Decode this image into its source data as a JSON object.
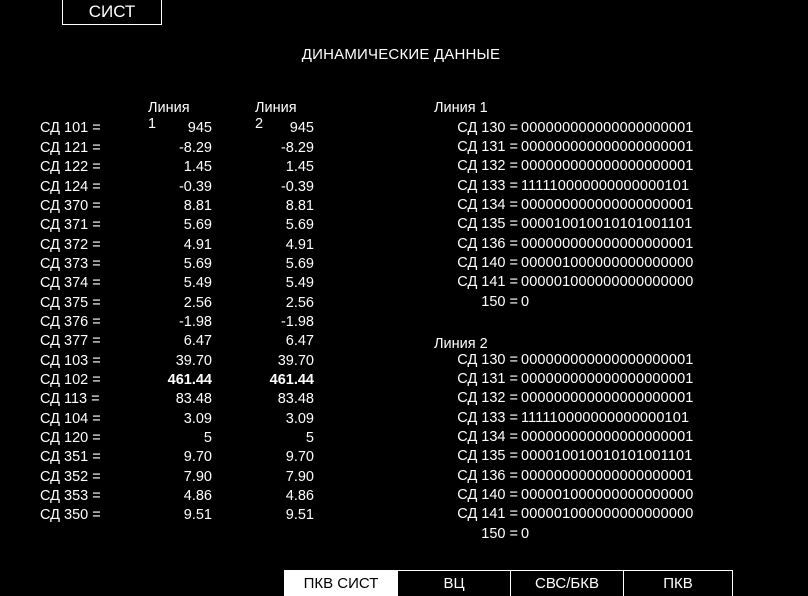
{
  "header": {
    "sist_button": "СИСТ",
    "title": "ДИНАМИЧЕСКИЕ ДАННЫЕ"
  },
  "left": {
    "col1": "Линия 1",
    "col2": "Линия 2",
    "rows": [
      {
        "label": "СД 101 =",
        "v1": "945",
        "v2": "945"
      },
      {
        "label": "СД 121 =",
        "v1": "-8.29",
        "v2": "-8.29"
      },
      {
        "label": "СД 122 =",
        "v1": "1.45",
        "v2": "1.45"
      },
      {
        "label": "СД 124 =",
        "v1": "-0.39",
        "v2": "-0.39"
      },
      {
        "label": "СД 370 =",
        "v1": "8.81",
        "v2": "8.81"
      },
      {
        "label": "СД 371 =",
        "v1": "5.69",
        "v2": "5.69"
      },
      {
        "label": "СД 372 =",
        "v1": "4.91",
        "v2": "4.91"
      },
      {
        "label": "СД 373 =",
        "v1": "5.69",
        "v2": "5.69"
      },
      {
        "label": "СД 374 =",
        "v1": "5.49",
        "v2": "5.49"
      },
      {
        "label": "СД 375 =",
        "v1": "2.56",
        "v2": "2.56"
      },
      {
        "label": "СД 376 =",
        "v1": "-1.98",
        "v2": "-1.98"
      },
      {
        "label": "СД 377 =",
        "v1": "6.47",
        "v2": "6.47"
      },
      {
        "label": "СД 103 =",
        "v1": "39.70",
        "v2": "39.70"
      },
      {
        "label": "СД 102 =",
        "v1": "461.44",
        "v2": "461.44"
      },
      {
        "label": "СД 113 =",
        "v1": "83.48",
        "v2": "83.48"
      },
      {
        "label": "СД 104 =",
        "v1": "3.09",
        "v2": "3.09"
      },
      {
        "label": "СД 120 =",
        "v1": "5",
        "v2": "5"
      },
      {
        "label": "СД 351 =",
        "v1": "9.70",
        "v2": "9.70"
      },
      {
        "label": "СД 352 =",
        "v1": "7.90",
        "v2": "7.90"
      },
      {
        "label": "СД 353 =",
        "v1": "4.86",
        "v2": "4.86"
      },
      {
        "label": "СД 350 =",
        "v1": "9.51",
        "v2": "9.51"
      }
    ]
  },
  "right": {
    "line1": {
      "header": "Линия 1",
      "rows": [
        {
          "label": "СД 130 =",
          "value": "000000000000000000001"
        },
        {
          "label": "СД 131 =",
          "value": "000000000000000000001"
        },
        {
          "label": "СД 132 =",
          "value": "000000000000000000001"
        },
        {
          "label": "СД 133 =",
          "value": "111110000000000000101"
        },
        {
          "label": "СД 134 =",
          "value": "000000000000000000001"
        },
        {
          "label": "СД 135 =",
          "value": "000010010010101001101"
        },
        {
          "label": "СД 136 =",
          "value": "000000000000000000001"
        },
        {
          "label": "СД 140 =",
          "value": "000001000000000000000"
        },
        {
          "label": "СД 141 =",
          "value": "000001000000000000000"
        },
        {
          "label": "150 =",
          "value": "0"
        }
      ]
    },
    "line2": {
      "header": "Линия  2",
      "rows": [
        {
          "label": "СД 130 =",
          "value": "000000000000000000001"
        },
        {
          "label": "СД 131 =",
          "value": "000000000000000000001"
        },
        {
          "label": "СД 132 =",
          "value": "000000000000000000001"
        },
        {
          "label": "СД 133 =",
          "value": "111110000000000000101"
        },
        {
          "label": "СД 134 =",
          "value": "000000000000000000001"
        },
        {
          "label": "СД 135 =",
          "value": "000010010010101001101"
        },
        {
          "label": "СД 136 =",
          "value": "000000000000000000001"
        },
        {
          "label": "СД 140 =",
          "value": "000001000000000000000"
        },
        {
          "label": "СД 141 =",
          "value": "000001000000000000000"
        },
        {
          "label": "150 =",
          "value": "0"
        }
      ]
    }
  },
  "tabs": [
    {
      "label": "ПКВ СИСТ",
      "active": true
    },
    {
      "label": "ВЦ",
      "active": false
    },
    {
      "label": "СВС/БКВ",
      "active": false
    },
    {
      "label": "ПКВ",
      "active": false
    }
  ],
  "colors": {
    "background": "#000000",
    "foreground": "#ffffff"
  }
}
